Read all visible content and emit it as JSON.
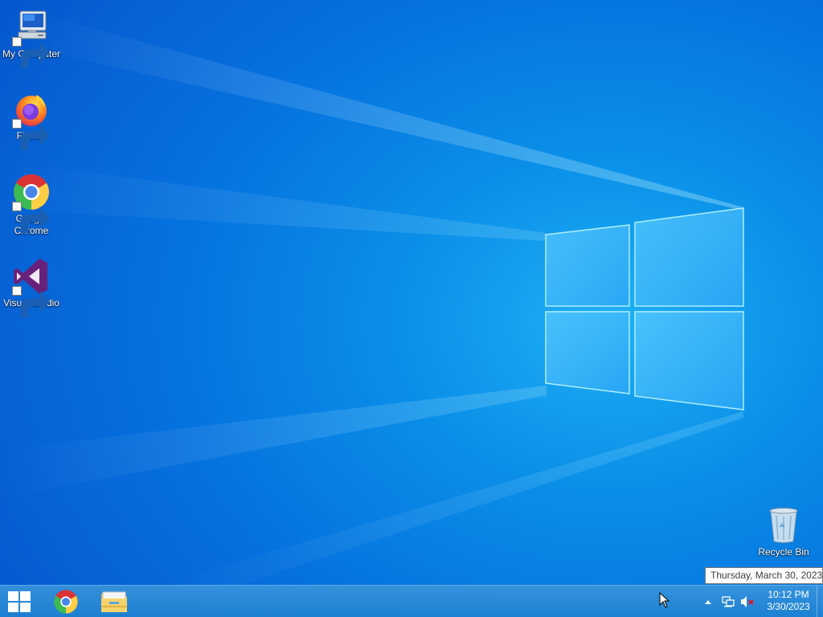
{
  "desktop": {
    "icons": [
      {
        "label": "My Computer",
        "icon": "computer-icon"
      },
      {
        "label": "Firefox",
        "icon": "firefox-icon"
      },
      {
        "label": "Google Chrome",
        "icon": "chrome-icon"
      },
      {
        "label": "Visual Studio",
        "icon": "visual-studio-icon"
      },
      {
        "label": "Recycle Bin",
        "icon": "recycle-bin-icon"
      }
    ]
  },
  "tooltip": {
    "text": "Thursday, March 30, 2023"
  },
  "taskbar": {
    "start_icon": "windows-start-icon",
    "pinned": [
      {
        "icon": "chrome-icon"
      },
      {
        "icon": "file-explorer-icon"
      }
    ],
    "tray": {
      "icons": [
        "show-hidden-icons-icon",
        "network-icon",
        "volume-muted-icon"
      ],
      "time": "10:12 PM",
      "date": "3/30/2023"
    }
  },
  "colors": {
    "wallpaper": "#0a8fe8",
    "taskbar": "#2a86d2",
    "logo": "#8fe3ff"
  }
}
